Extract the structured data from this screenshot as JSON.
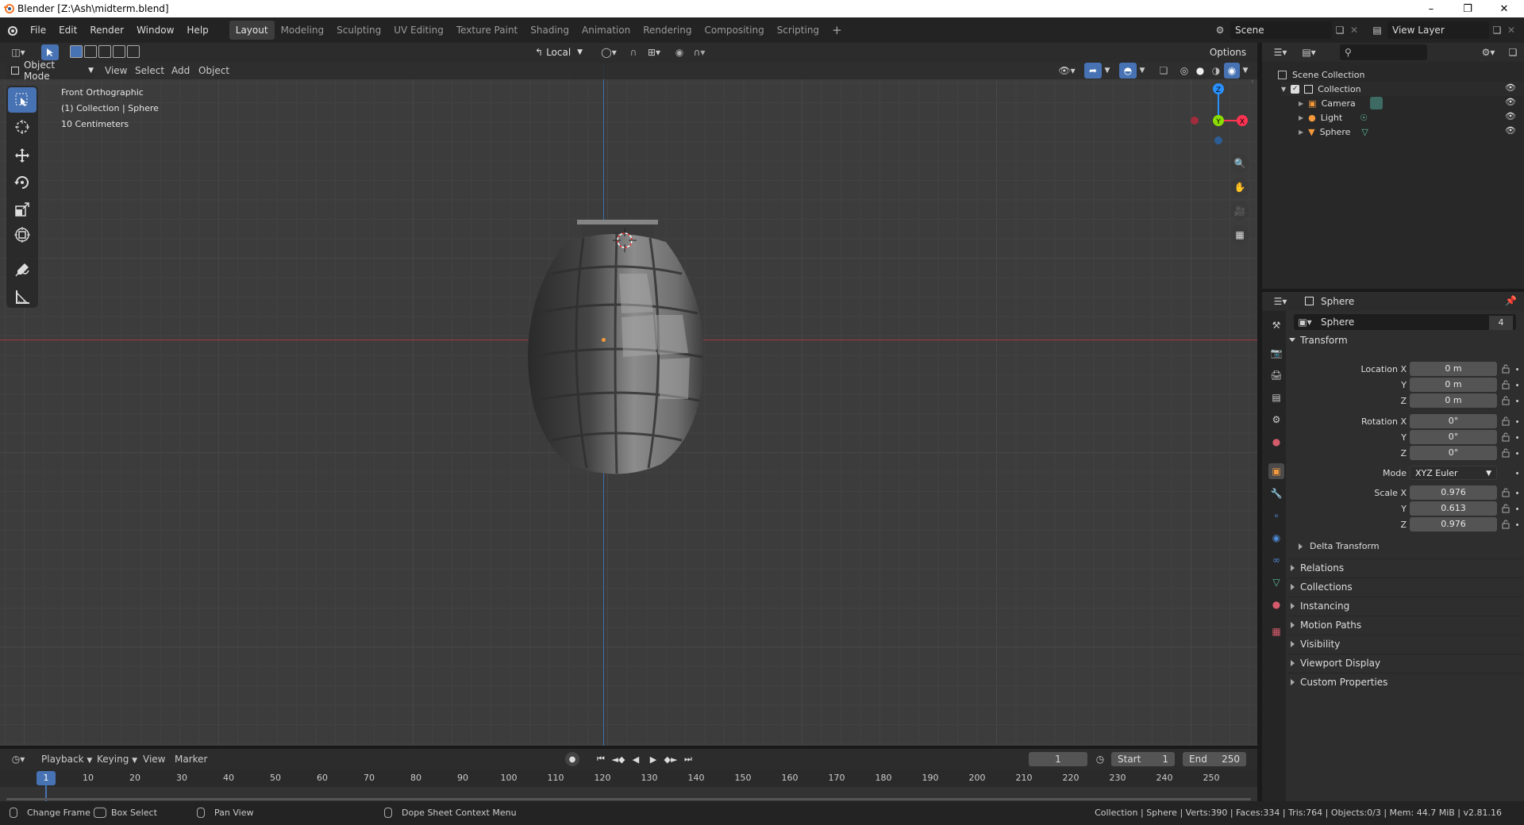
{
  "window": {
    "title": "Blender [Z:\\Ash\\midterm.blend]"
  },
  "menus": [
    "File",
    "Edit",
    "Render",
    "Window",
    "Help"
  ],
  "workspaces": [
    "Layout",
    "Modeling",
    "Sculpting",
    "UV Editing",
    "Texture Paint",
    "Shading",
    "Animation",
    "Rendering",
    "Compositing",
    "Scripting"
  ],
  "active_workspace": "Layout",
  "scene": {
    "name": "Scene",
    "view_layer": "View Layer"
  },
  "viewport_header": {
    "mode": "Object Mode",
    "menus": [
      "View",
      "Select",
      "Add",
      "Object"
    ],
    "transform_orientation": "Local",
    "options": "Options"
  },
  "viewport_overlay": {
    "view_name": "Front Orthographic",
    "collection_info": "(1) Collection | Sphere",
    "scale": "10 Centimeters"
  },
  "gizmo": {
    "z": "Z",
    "y": "Y",
    "x": "X"
  },
  "outliner": {
    "root": "Scene Collection",
    "collection": "Collection",
    "items": [
      "Camera",
      "Light",
      "Sphere"
    ]
  },
  "properties": {
    "header_object": "Sphere",
    "object_name": "Sphere",
    "users": "4",
    "transform_title": "Transform",
    "location": {
      "label": "Location X",
      "x": "0 m",
      "y": "0 m",
      "z": "0 m"
    },
    "rotation": {
      "label": "Rotation X",
      "x": "0°",
      "y": "0°",
      "z": "0°"
    },
    "mode_label": "Mode",
    "mode": "XYZ Euler",
    "scale": {
      "label": "Scale X",
      "x": "0.976",
      "y": "0.613",
      "z": "0.976"
    },
    "axis_y": "Y",
    "axis_z": "Z",
    "delta": "Delta Transform",
    "sections": [
      "Relations",
      "Collections",
      "Instancing",
      "Motion Paths",
      "Visibility",
      "Viewport Display",
      "Custom Properties"
    ]
  },
  "timeline": {
    "menus": [
      "Playback",
      "Keying",
      "View",
      "Marker"
    ],
    "current_frame": "1",
    "start_label": "Start",
    "start": "1",
    "end_label": "End",
    "end": "250",
    "ticks": [
      "1",
      "10",
      "20",
      "30",
      "40",
      "50",
      "60",
      "70",
      "80",
      "90",
      "100",
      "110",
      "120",
      "130",
      "140",
      "150",
      "160",
      "170",
      "180",
      "190",
      "200",
      "210",
      "220",
      "230",
      "240",
      "250"
    ]
  },
  "statusbar": {
    "change_frame": "Change Frame",
    "box_select": "Box Select",
    "pan_view": "Pan View",
    "context_menu": "Dope Sheet Context Menu",
    "stats": "Collection | Sphere | Verts:390 | Faces:334 | Tris:764 | Objects:0/3 | Mem: 44.7 MiB | v2.81.16"
  },
  "colors": {
    "accent": "#4772b3",
    "x_axis": "#ff3352",
    "y_axis": "#8bdc00",
    "z_axis": "#2890ff",
    "object_orange": "#f59a3b"
  }
}
